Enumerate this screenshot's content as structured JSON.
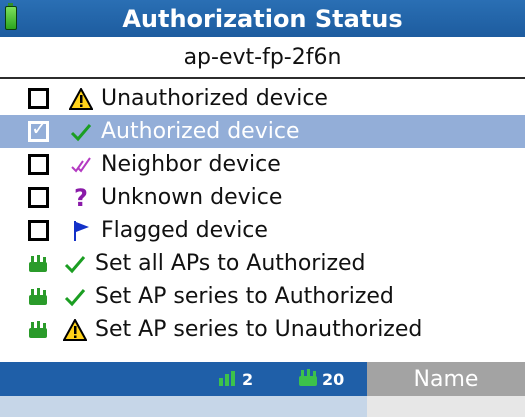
{
  "header": {
    "title": "Authorization Status",
    "subtitle": "ap-evt-fp-2f6n",
    "battery_icon": "battery-icon"
  },
  "items": [
    {
      "label": "Unauthorized device",
      "checked": false,
      "icon": "warning-triangle-icon"
    },
    {
      "label": "Authorized device",
      "checked": true,
      "selected": true,
      "icon": "green-check-icon"
    },
    {
      "label": "Neighbor device",
      "checked": false,
      "icon": "purple-double-check-icon"
    },
    {
      "label": "Unknown device",
      "checked": false,
      "icon": "question-mark-icon"
    },
    {
      "label": "Flagged device",
      "checked": false,
      "icon": "blue-flag-icon"
    },
    {
      "label": "Set all APs to Authorized",
      "icon": "green-check-icon"
    },
    {
      "label": "Set AP series to Authorized",
      "icon": "green-check-icon"
    },
    {
      "label": "Set AP series to Unauthorized",
      "icon": "warning-triangle-icon"
    }
  ],
  "footer": {
    "signal_count": "2",
    "ap_count": "20",
    "softkey_label": "Name"
  },
  "colors": {
    "header_bg": "#1d5c9f",
    "selected_bg": "#93aed8",
    "footer_bg": "#1f5fa8",
    "softkey_bg": "#a3a3a3"
  }
}
